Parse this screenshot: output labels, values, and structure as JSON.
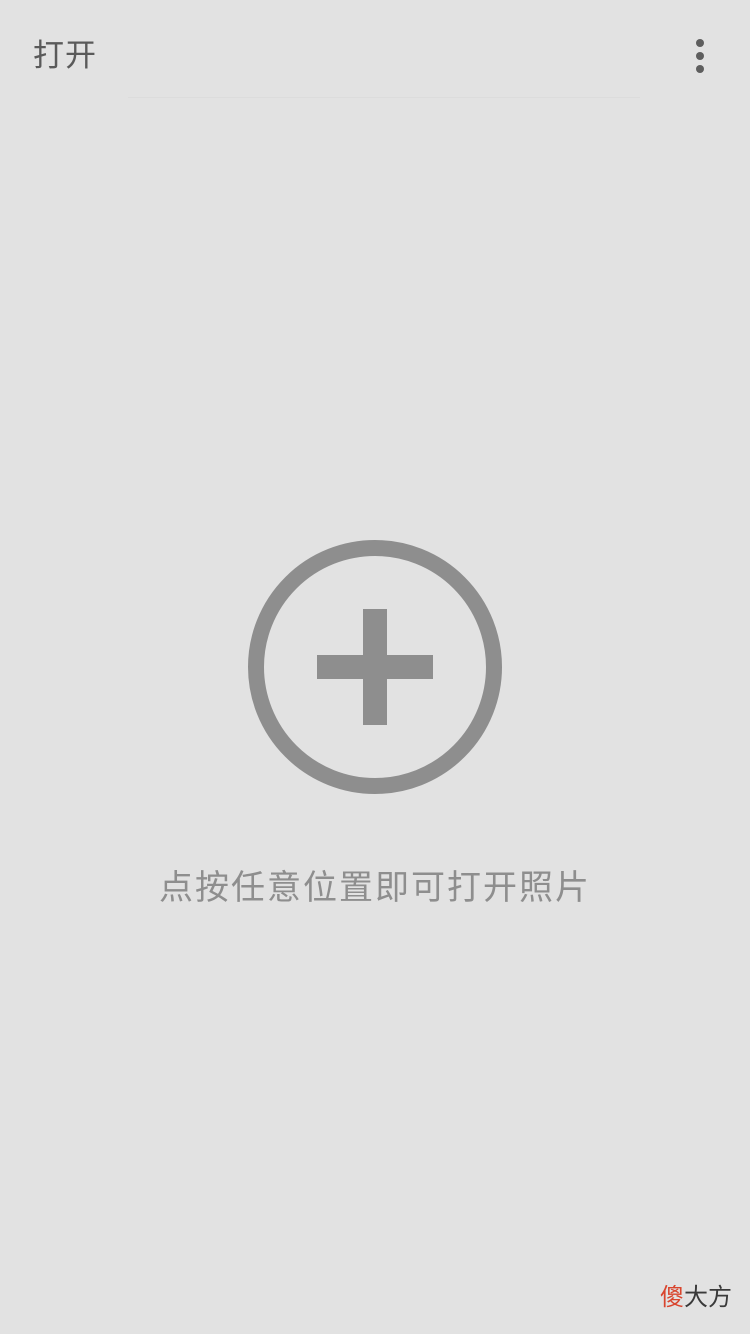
{
  "app_bar": {
    "title": "打开",
    "menu_icon": "more-vertical-icon"
  },
  "main": {
    "icon": "add-circle-icon",
    "hint": "点按任意位置即可打开照片"
  },
  "watermark": {
    "first_char": "傻",
    "rest": "大方"
  },
  "colors": {
    "background": "#e2e2e2",
    "icon": "#8e8e8e",
    "title_text": "#5a5a5a",
    "watermark_accent": "#d9452e"
  }
}
